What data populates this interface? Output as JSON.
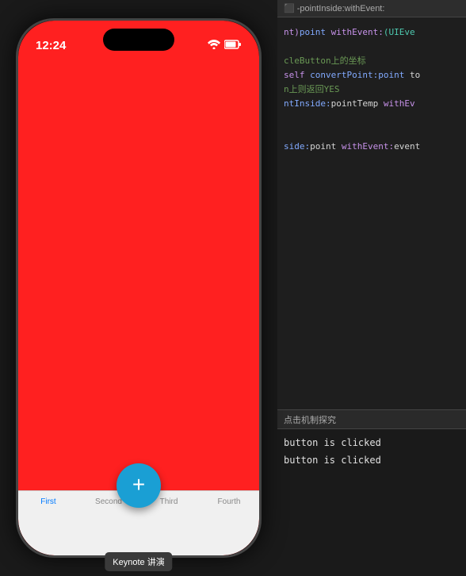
{
  "phone": {
    "status_time": "12:24",
    "wifi_icon": "wifi",
    "battery_icon": "battery",
    "fab_icon": "+",
    "tabs": [
      {
        "label": "First",
        "active": true
      },
      {
        "label": "Second",
        "active": false
      },
      {
        "label": "Third",
        "active": false
      },
      {
        "label": "Fourth",
        "active": false
      }
    ],
    "tooltip": "Keynote 讲演"
  },
  "code_panel": {
    "topbar_text": "⬛ -pointInside:withEvent:",
    "lines": [
      {
        "text": "nt)point withEvent:(UIEve",
        "classes": "code-plain"
      },
      {
        "text": "",
        "classes": "code-plain"
      },
      {
        "text": "cleButton上的坐标",
        "classes": "code-comment"
      },
      {
        "text": "self convertPoint:point to",
        "classes": "code-plain"
      },
      {
        "text": "n上则返回YES",
        "classes": "code-comment"
      },
      {
        "text": "ntInside:pointTemp withEv",
        "classes": "code-plain"
      },
      {
        "text": "",
        "classes": "code-plain"
      },
      {
        "text": "",
        "classes": "code-plain"
      },
      {
        "text": "side:point withEvent:event",
        "classes": "code-plain"
      }
    ],
    "console": {
      "header": "点击机制探究",
      "output_lines": [
        "button is clicked",
        "button is clicked"
      ]
    }
  }
}
